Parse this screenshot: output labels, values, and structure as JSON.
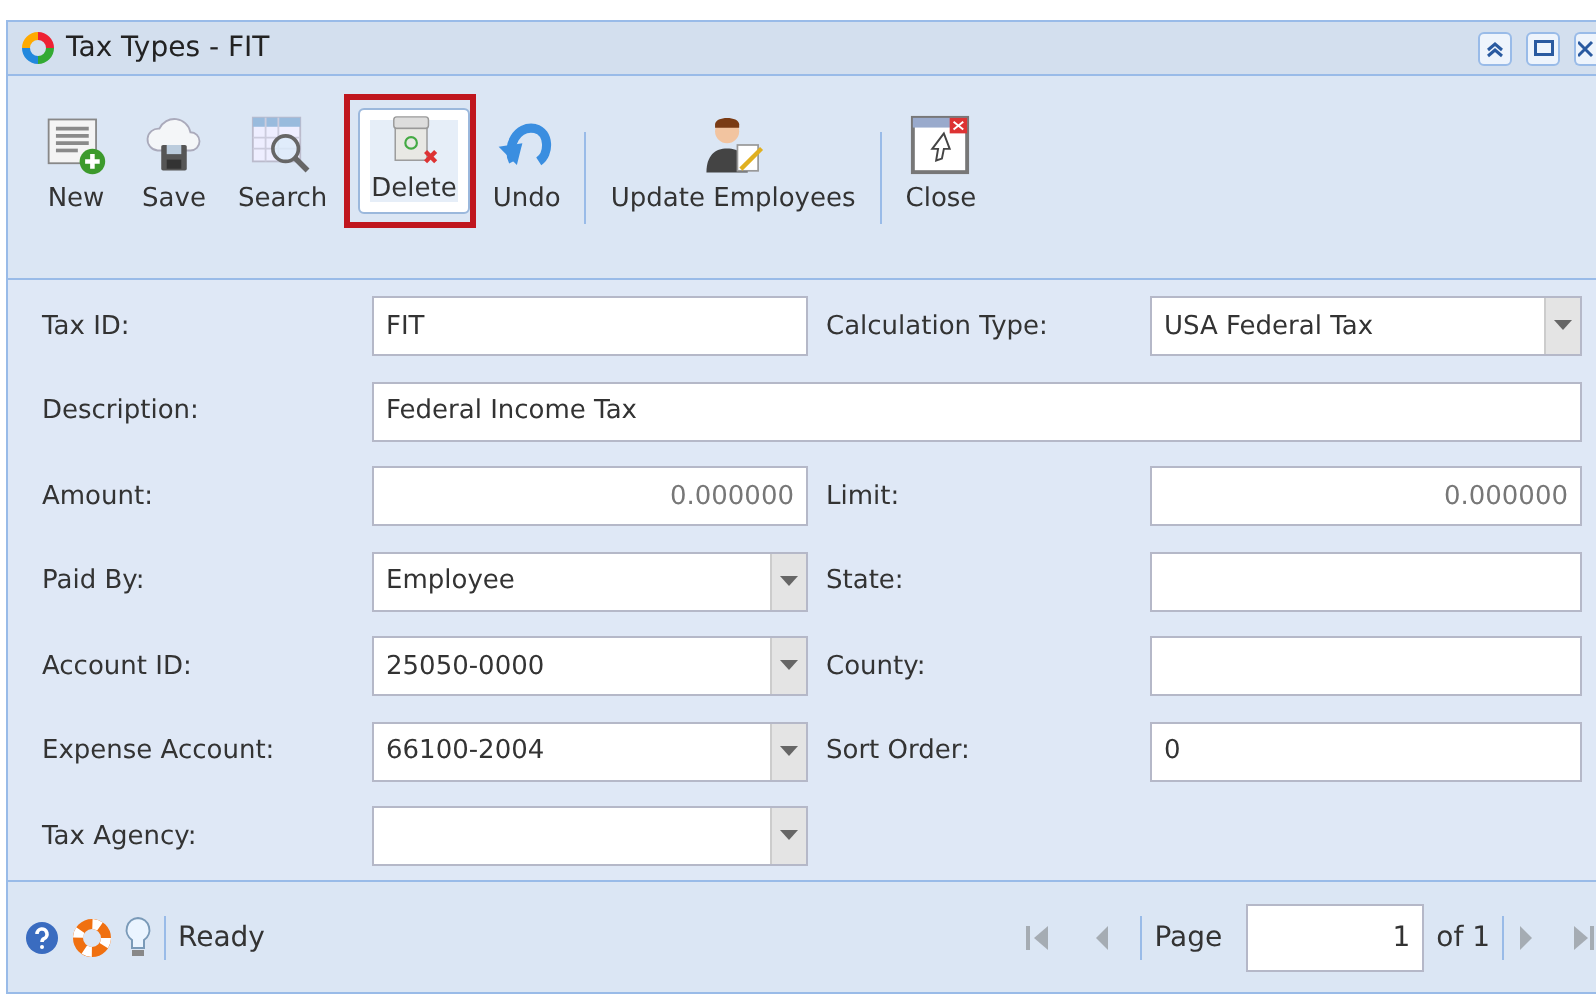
{
  "window": {
    "title": "Tax Types - FIT"
  },
  "toolbar": [
    {
      "label": "New",
      "highlighted": false,
      "separator_after": false
    },
    {
      "label": "Save",
      "highlighted": false,
      "separator_after": false
    },
    {
      "label": "Search",
      "highlighted": false,
      "separator_after": false
    },
    {
      "label": "Delete",
      "highlighted": true,
      "separator_after": false
    },
    {
      "label": "Undo",
      "highlighted": false,
      "separator_after": true
    },
    {
      "label": "Update Employees",
      "highlighted": false,
      "separator_after": true
    },
    {
      "label": "Close",
      "highlighted": false,
      "separator_after": false
    }
  ],
  "form": {
    "rows": [
      {
        "kind": "pair",
        "fields": [
          {
            "label": "Tax ID:",
            "value": "FIT",
            "kind": "text"
          },
          {
            "label": "Calculation Type:",
            "value": "USA Federal Tax",
            "kind": "select"
          }
        ]
      },
      {
        "kind": "wide",
        "fields": [
          {
            "label": "Description:",
            "value": "Federal Income Tax",
            "kind": "text"
          }
        ]
      },
      {
        "kind": "pair",
        "fields": [
          {
            "label": "Amount:",
            "value": "0.000000",
            "kind": "number"
          },
          {
            "label": "Limit:",
            "value": "0.000000",
            "kind": "number"
          }
        ]
      },
      {
        "kind": "pair",
        "fields": [
          {
            "label": "Paid By:",
            "value": "Employee",
            "kind": "select"
          },
          {
            "label": "State:",
            "kind": "text"
          }
        ]
      },
      {
        "kind": "pair",
        "fields": [
          {
            "label": "Account ID:",
            "value": "25050-0000",
            "kind": "select"
          },
          {
            "label": "County:",
            "kind": "text"
          }
        ]
      },
      {
        "kind": "pair",
        "fields": [
          {
            "label": "Expense Account:",
            "value": "66100-2004",
            "kind": "select"
          },
          {
            "label": "Sort Order:",
            "value": "0",
            "kind": "text"
          }
        ]
      },
      {
        "kind": "pair",
        "fields": [
          {
            "label": "Tax Agency:",
            "kind": "select"
          }
        ]
      }
    ]
  },
  "status_bar": {
    "status": "Ready",
    "page_label": "Page",
    "page": "1",
    "of": "of 1"
  }
}
